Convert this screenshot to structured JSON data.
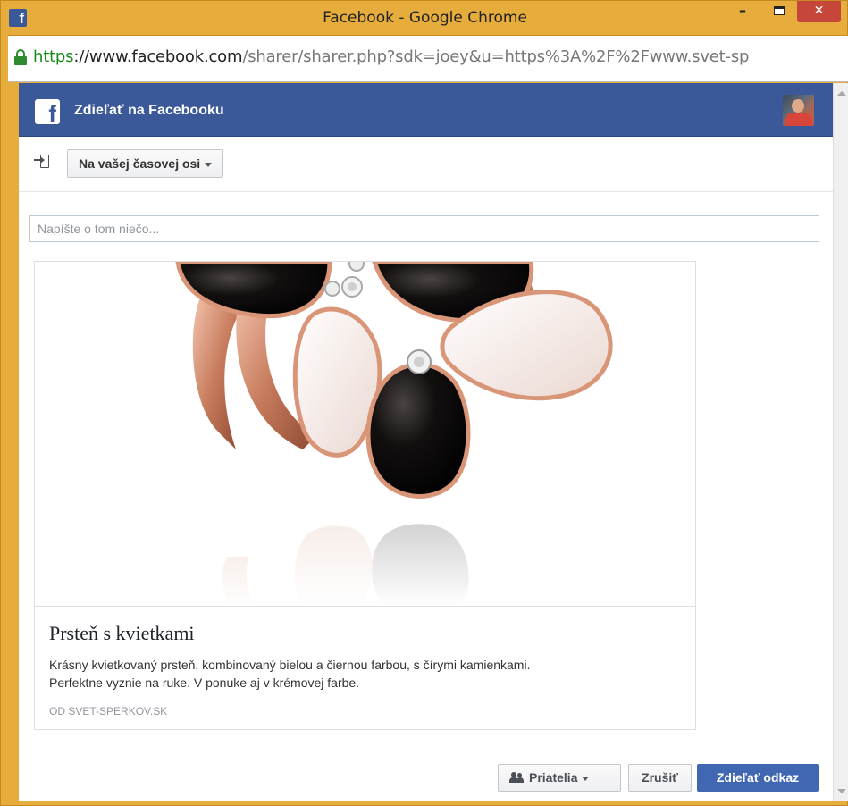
{
  "window": {
    "title": "Facebook - Google Chrome",
    "icon": "facebook-icon",
    "minimize": "–",
    "close": "✕"
  },
  "address": {
    "scheme": "https",
    "host": "://www.facebook.com",
    "rest": "/sharer/sharer.php?sdk=joey&u=https%3A%2F%2Fwww.svet-sp"
  },
  "dialog": {
    "header_title": "Zdieľať na Facebooku",
    "logo_letter": "f",
    "target_label": "Na vašej časovej osi",
    "message_placeholder": "Napíšte o tom niečo..."
  },
  "preview": {
    "title": "Prsteň s kvietkami",
    "description_line1": "Krásny kvietkovaný prsteň, kombinovaný bielou a čiernou farbou, s čírymi kamienkami.",
    "description_line2": "Perfektne vyznie na ruke. V ponuke aj v krémovej farbe.",
    "source": "OD SVET-SPERKOV.SK"
  },
  "footer": {
    "audience_label": "Priatelia",
    "cancel_label": "Zrušiť",
    "share_label": "Zdieľať odkaz"
  },
  "colors": {
    "fb_blue": "#3b5998",
    "share_button": "#4267b2",
    "window_frame": "#e6ad3c",
    "close_button": "#c7463a"
  }
}
